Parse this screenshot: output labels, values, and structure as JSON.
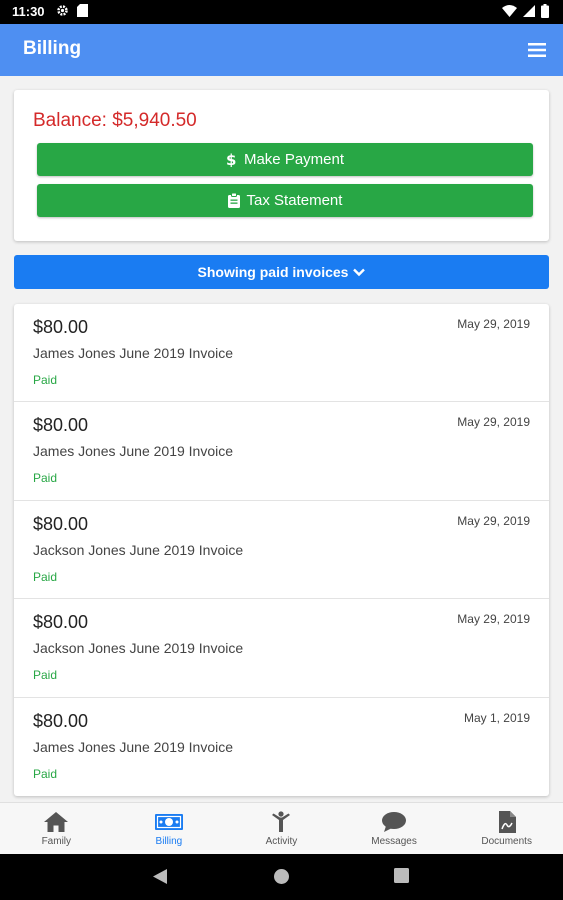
{
  "status_bar": {
    "time": "11:30",
    "icons": [
      "settings-icon",
      "sd-card-icon",
      "wifi-icon",
      "signal-icon",
      "battery-icon"
    ]
  },
  "app_bar": {
    "title": "Billing",
    "menu_icon": "hamburger-menu-icon"
  },
  "balance": {
    "text": "Balance: $5,940.50",
    "buttons": {
      "make_payment": "Make Payment",
      "tax_statement": "Tax Statement"
    }
  },
  "filter": {
    "label": "Showing paid invoices"
  },
  "invoices": [
    {
      "amount": "$80.00",
      "date": "May 29, 2019",
      "description": "James Jones June 2019 Invoice",
      "status": "Paid"
    },
    {
      "amount": "$80.00",
      "date": "May 29, 2019",
      "description": "James Jones June 2019 Invoice",
      "status": "Paid"
    },
    {
      "amount": "$80.00",
      "date": "May 29, 2019",
      "description": "Jackson Jones June 2019 Invoice",
      "status": "Paid"
    },
    {
      "amount": "$80.00",
      "date": "May 29, 2019",
      "description": "Jackson Jones June 2019 Invoice",
      "status": "Paid"
    },
    {
      "amount": "$80.00",
      "date": "May 1, 2019",
      "description": "James Jones June 2019 Invoice",
      "status": "Paid"
    }
  ],
  "bottom_nav": [
    {
      "label": "Family",
      "icon": "home-icon",
      "active": false
    },
    {
      "label": "Billing",
      "icon": "money-icon",
      "active": true
    },
    {
      "label": "Activity",
      "icon": "person-activity-icon",
      "active": false
    },
    {
      "label": "Messages",
      "icon": "chat-icon",
      "active": false
    },
    {
      "label": "Documents",
      "icon": "document-icon",
      "active": false
    }
  ],
  "colors": {
    "app_bar": "#4e8ff2",
    "balance_text": "#d42a2a",
    "button_green": "#28a745",
    "filter_blue": "#1a7cf2",
    "paid_green": "#28a745"
  }
}
